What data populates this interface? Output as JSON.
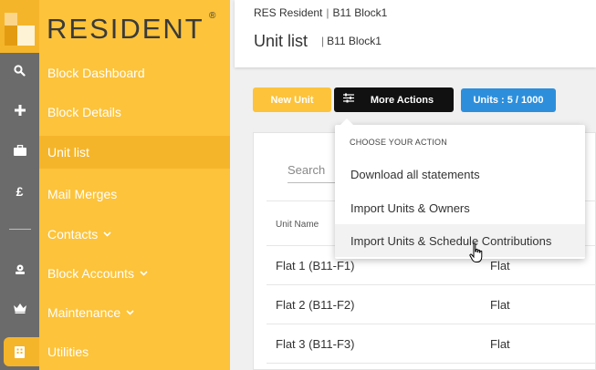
{
  "brand": {
    "name": "RESIDENT",
    "reg": "®"
  },
  "rail": {
    "icons": [
      "search-icon",
      "plus-icon",
      "briefcase-icon",
      "pound-icon",
      "menu-icon",
      "support-icon",
      "crown-icon",
      "utilities-icon"
    ],
    "glyphs": {
      "search": "🔍",
      "plus": "+",
      "briefcase": "▬",
      "pound": "£",
      "support": "⚙",
      "crown": "♛",
      "utilities": "▦"
    }
  },
  "sidebar": {
    "items": [
      {
        "label": "Block Dashboard"
      },
      {
        "label": "Block Details"
      },
      {
        "label": "Unit list"
      },
      {
        "label": "Mail Merges"
      },
      {
        "label": "Contacts",
        "chevron": "⌄"
      },
      {
        "label": "Block Accounts",
        "chevron": "⌄"
      },
      {
        "label": "Maintenance",
        "chevron": "⌄"
      },
      {
        "label": "Utilities"
      }
    ]
  },
  "header": {
    "crumb_1": "RES Resident",
    "crumb_sep": "|",
    "crumb_2": "B11 Block1",
    "title": "Unit list",
    "subtitle": "B11 Block1"
  },
  "toolbar": {
    "new_unit": "New Unit",
    "more_actions": "More Actions",
    "units_badge": "Units : 5 / 1000",
    "sliders_glyph": "☰"
  },
  "search": {
    "placeholder": "Search"
  },
  "table": {
    "headers": [
      "Unit Name",
      ""
    ],
    "rows": [
      [
        "Flat 1 (B11-F1)",
        "Flat"
      ],
      [
        "Flat 2 (B11-F2)",
        "Flat"
      ],
      [
        "Flat 3 (B11-F3)",
        "Flat"
      ]
    ]
  },
  "dropdown": {
    "heading": "CHOOSE YOUR ACTION",
    "items": [
      {
        "label": "Download all statements"
      },
      {
        "label": "Import Units & Owners"
      },
      {
        "label": "Import Units & Schedule Contributions"
      }
    ]
  },
  "colors": {
    "sidebar": "#fcc33b",
    "rail": "#6b6b6b",
    "active": "#f5b52a",
    "blue": "#2d8fdc"
  }
}
